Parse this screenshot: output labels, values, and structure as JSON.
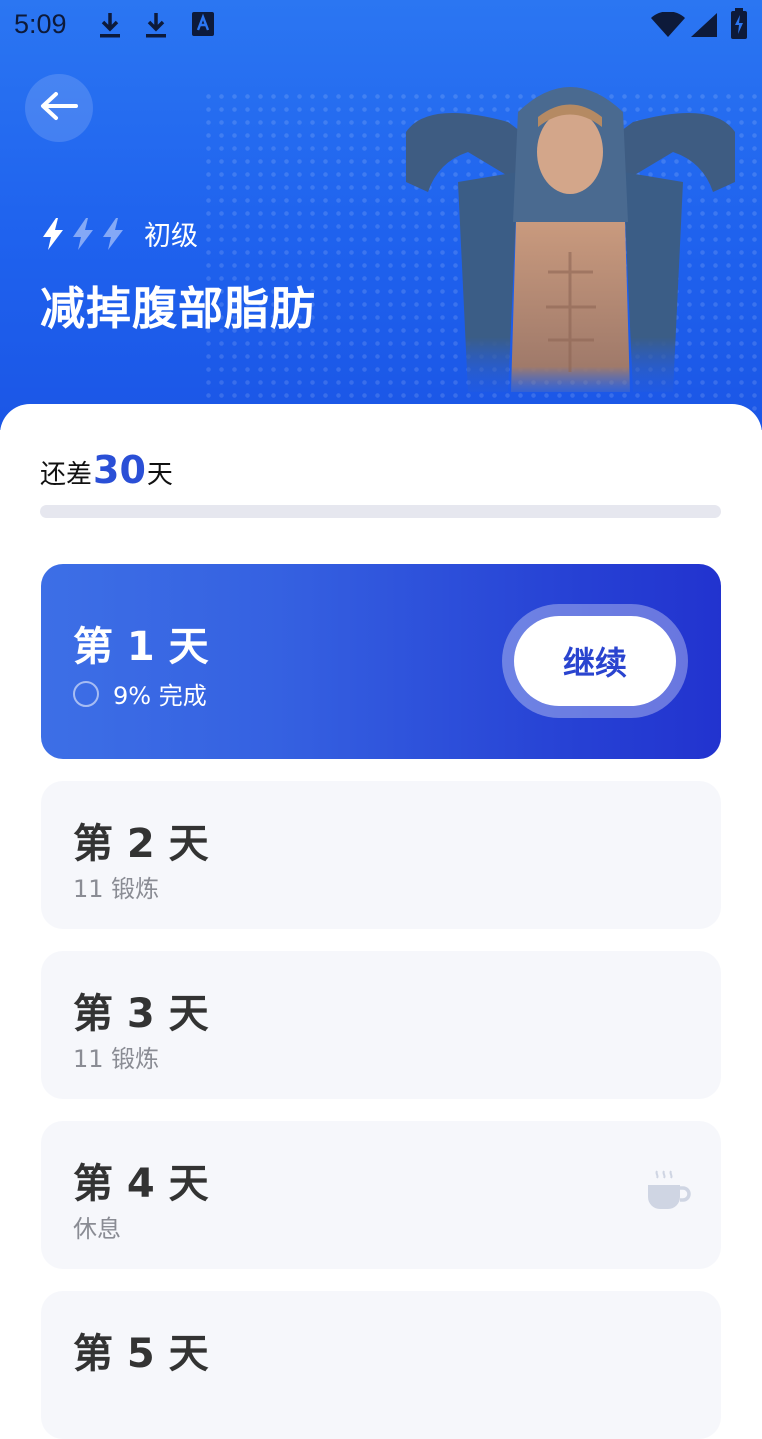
{
  "status_bar": {
    "time": "5:09"
  },
  "header": {
    "level_label": "初级",
    "level_bolts": {
      "filled": 1,
      "total": 3
    },
    "title": "减掉腹部脂肪"
  },
  "progress": {
    "prefix": "还差",
    "days_left": "30",
    "suffix": "天",
    "fraction": 0.0
  },
  "days": [
    {
      "title": "第 1 天",
      "subtitle": "9% 完成",
      "action": "继续",
      "active": true
    },
    {
      "title": "第 2 天",
      "subtitle": "11 锻炼"
    },
    {
      "title": "第 3 天",
      "subtitle": "11 锻炼"
    },
    {
      "title": "第 4 天",
      "subtitle": "休息",
      "icon": "coffee-cup-icon"
    },
    {
      "title": "第 5 天"
    }
  ],
  "colors": {
    "accent": "#2a4fd6",
    "hero": "#1f62ee",
    "card_bg": "#f6f7fb"
  }
}
